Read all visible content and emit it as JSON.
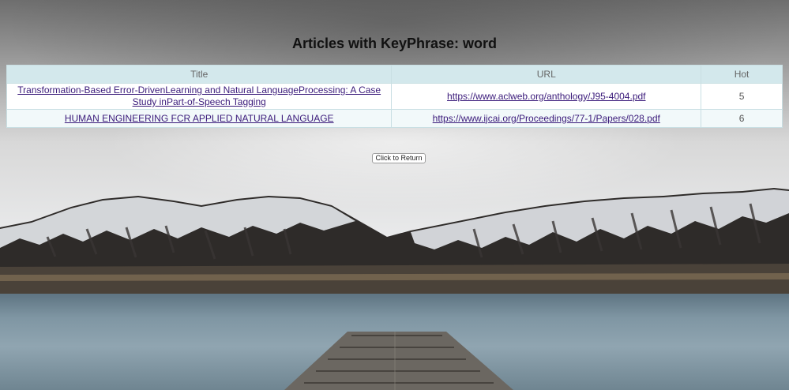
{
  "page": {
    "title": "Articles with KeyPhrase: word"
  },
  "table": {
    "headers": {
      "title": "Title",
      "url": "URL",
      "hot": "Hot"
    },
    "rows": [
      {
        "title": "Transformation-Based Error-DrivenLearning and Natural LanguageProcessing: A Case Study inPart-of-Speech Tagging",
        "url": "https://www.aclweb.org/anthology/J95-4004.pdf",
        "hot": "5"
      },
      {
        "title": "HUMAN ENGINEERING FCR APPLIED NATURAL LANGUAGE",
        "url": "https://www.ijcai.org/Proceedings/77-1/Papers/028.pdf",
        "hot": "6"
      }
    ]
  },
  "actions": {
    "return_label": "Click to Return"
  },
  "colors": {
    "header_bg": "#d3e8ec",
    "row_bg": "#f2f9fa",
    "link": "#3a1a7a",
    "border": "#c9dfe3"
  }
}
